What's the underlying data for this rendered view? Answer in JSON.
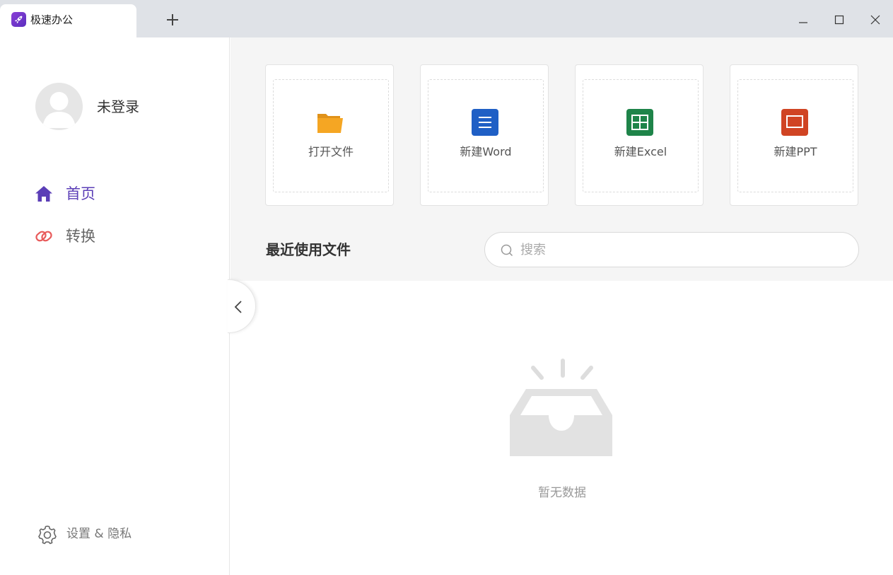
{
  "window": {
    "tab_title": "极速办公",
    "new_tab_icon": "plus-icon",
    "controls": [
      "minimize-icon",
      "maximize-icon",
      "close-icon"
    ]
  },
  "sidebar": {
    "user_name": "未登录",
    "nav": [
      {
        "label": "首页",
        "icon": "home-icon",
        "active": true
      },
      {
        "label": "转换",
        "icon": "convert-icon",
        "active": false
      }
    ],
    "settings_label": "设置 & 隐私"
  },
  "quick_actions": [
    {
      "label": "打开文件",
      "icon": "folder-icon",
      "color": "#f5a623"
    },
    {
      "label": "新建Word",
      "icon": "word-doc-icon",
      "color": "#1f5fc5"
    },
    {
      "label": "新建Excel",
      "icon": "excel-sheet-icon",
      "color": "#1e8449"
    },
    {
      "label": "新建PPT",
      "icon": "ppt-slide-icon",
      "color": "#d04423"
    }
  ],
  "recent": {
    "title": "最近使用文件",
    "search_placeholder": "搜索",
    "empty_text": "暂无数据"
  },
  "colors": {
    "accent": "#5b3eb7",
    "titlebar": "#dfe2e7",
    "content_bg": "#f5f5f5"
  }
}
